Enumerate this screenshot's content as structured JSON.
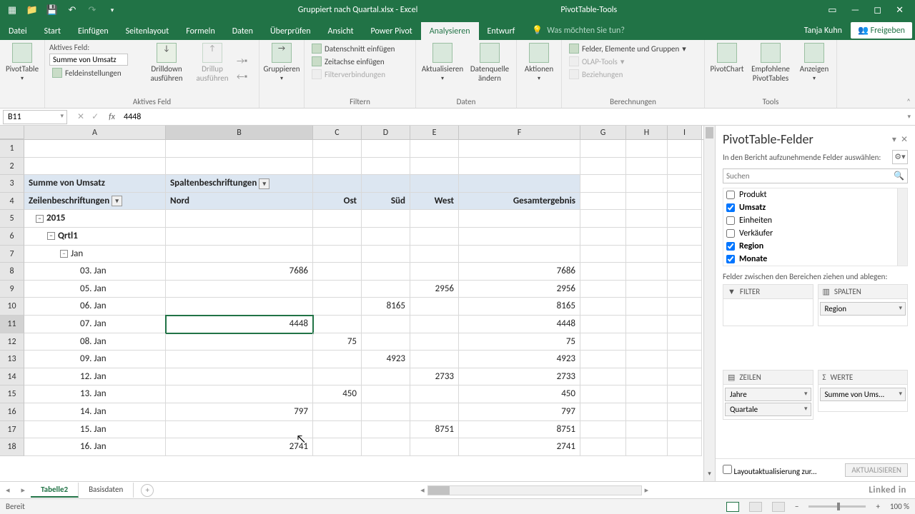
{
  "titlebar": {
    "filename": "Gruppiert nach Quartal.xlsx - Excel",
    "context": "PivotTable-Tools"
  },
  "tabs": {
    "items": [
      "Datei",
      "Start",
      "Einfügen",
      "Seitenlayout",
      "Formeln",
      "Daten",
      "Überprüfen",
      "Ansicht",
      "Power Pivot",
      "Analysieren",
      "Entwurf"
    ],
    "active": "Analysieren",
    "tell": "Was möchten Sie tun?",
    "user": "Tanja Kuhn",
    "share": "Freigeben"
  },
  "ribbon": {
    "pivotBtn": "PivotTable",
    "activeField": {
      "groupLabel": "Aktives Feld",
      "label": "Aktives Feld:",
      "value": "Summe von Umsatz",
      "settings": "Feldeinstellungen",
      "drilldown": "Drilldown ausführen",
      "drillup": "Drillup ausführen"
    },
    "groupBtn": "Gruppieren",
    "filter": {
      "groupLabel": "Filtern",
      "slicer": "Datenschnitt einfügen",
      "timeline": "Zeitachse einfügen",
      "conn": "Filterverbindungen"
    },
    "data": {
      "groupLabel": "Daten",
      "refresh": "Aktualisieren",
      "source": "Datenquelle ändern"
    },
    "actions": "Aktionen",
    "calc": {
      "groupLabel": "Berechnungen",
      "fields": "Felder, Elemente und Gruppen",
      "olap": "OLAP-Tools",
      "rel": "Beziehungen"
    },
    "tools": {
      "groupLabel": "Tools",
      "chart": "PivotChart",
      "recommend": "Empfohlene PivotTables",
      "show": "Anzeigen"
    }
  },
  "namebox": "B11",
  "formula": "4448",
  "cols": [
    "A",
    "B",
    "C",
    "D",
    "E",
    "F",
    "G",
    "H",
    "I"
  ],
  "pivot": {
    "sumLabel": "Summe von Umsatz",
    "colLabel": "Spaltenbeschriftungen",
    "rowLabel": "Zeilenbeschriftungen",
    "colHdrs": [
      "Nord",
      "Ost",
      "Süd",
      "West",
      "Gesamtergebnis"
    ],
    "year": "2015",
    "qtr": "Qrtl1",
    "month": "Jan"
  },
  "rows": [
    {
      "r": 8,
      "label": "03. Jan",
      "b": "7686",
      "f": "7686"
    },
    {
      "r": 9,
      "label": "05. Jan",
      "e": "2956",
      "f": "2956"
    },
    {
      "r": 10,
      "label": "06. Jan",
      "d": "8165",
      "f": "8165"
    },
    {
      "r": 11,
      "label": "07. Jan",
      "b": "4448",
      "f": "4448",
      "sel": true
    },
    {
      "r": 12,
      "label": "08. Jan",
      "c": "75",
      "f": "75"
    },
    {
      "r": 13,
      "label": "09. Jan",
      "d": "4923",
      "f": "4923"
    },
    {
      "r": 14,
      "label": "12. Jan",
      "e": "2733",
      "f": "2733"
    },
    {
      "r": 15,
      "label": "13. Jan",
      "c": "450",
      "f": "450"
    },
    {
      "r": 16,
      "label": "14. Jan",
      "b": "797",
      "f": "797"
    },
    {
      "r": 17,
      "label": "15. Jan",
      "e": "8751",
      "f": "8751"
    },
    {
      "r": 18,
      "label": "16. Jan",
      "b": "2741",
      "f": "2741"
    }
  ],
  "pane": {
    "title": "PivotTable-Felder",
    "desc": "In den Bericht aufzunehmende Felder auswählen:",
    "search": "Suchen",
    "fields": [
      {
        "name": "Produkt",
        "checked": false
      },
      {
        "name": "Umsatz",
        "checked": true
      },
      {
        "name": "Einheiten",
        "checked": false
      },
      {
        "name": "Verkäufer",
        "checked": false
      },
      {
        "name": "Region",
        "checked": true
      },
      {
        "name": "Monate",
        "checked": true
      },
      {
        "name": "Quartale",
        "checked": true
      }
    ],
    "dragDesc": "Felder zwischen den Bereichen ziehen und ablegen:",
    "zones": {
      "filter": "FILTER",
      "columns": "SPALTEN",
      "rows": "ZEILEN",
      "values": "WERTE",
      "colItem": "Region",
      "rowItems": [
        "Jahre",
        "Quartale"
      ],
      "valItem": "Summe von Ums..."
    },
    "defer": "Layoutaktualisierung zur...",
    "update": "AKTUALISIEREN"
  },
  "sheets": {
    "tabs": [
      "Tabelle2",
      "Basisdaten"
    ],
    "active": "Tabelle2"
  },
  "status": {
    "ready": "Bereit",
    "zoom": "100 %"
  },
  "watermark": "Linked in"
}
